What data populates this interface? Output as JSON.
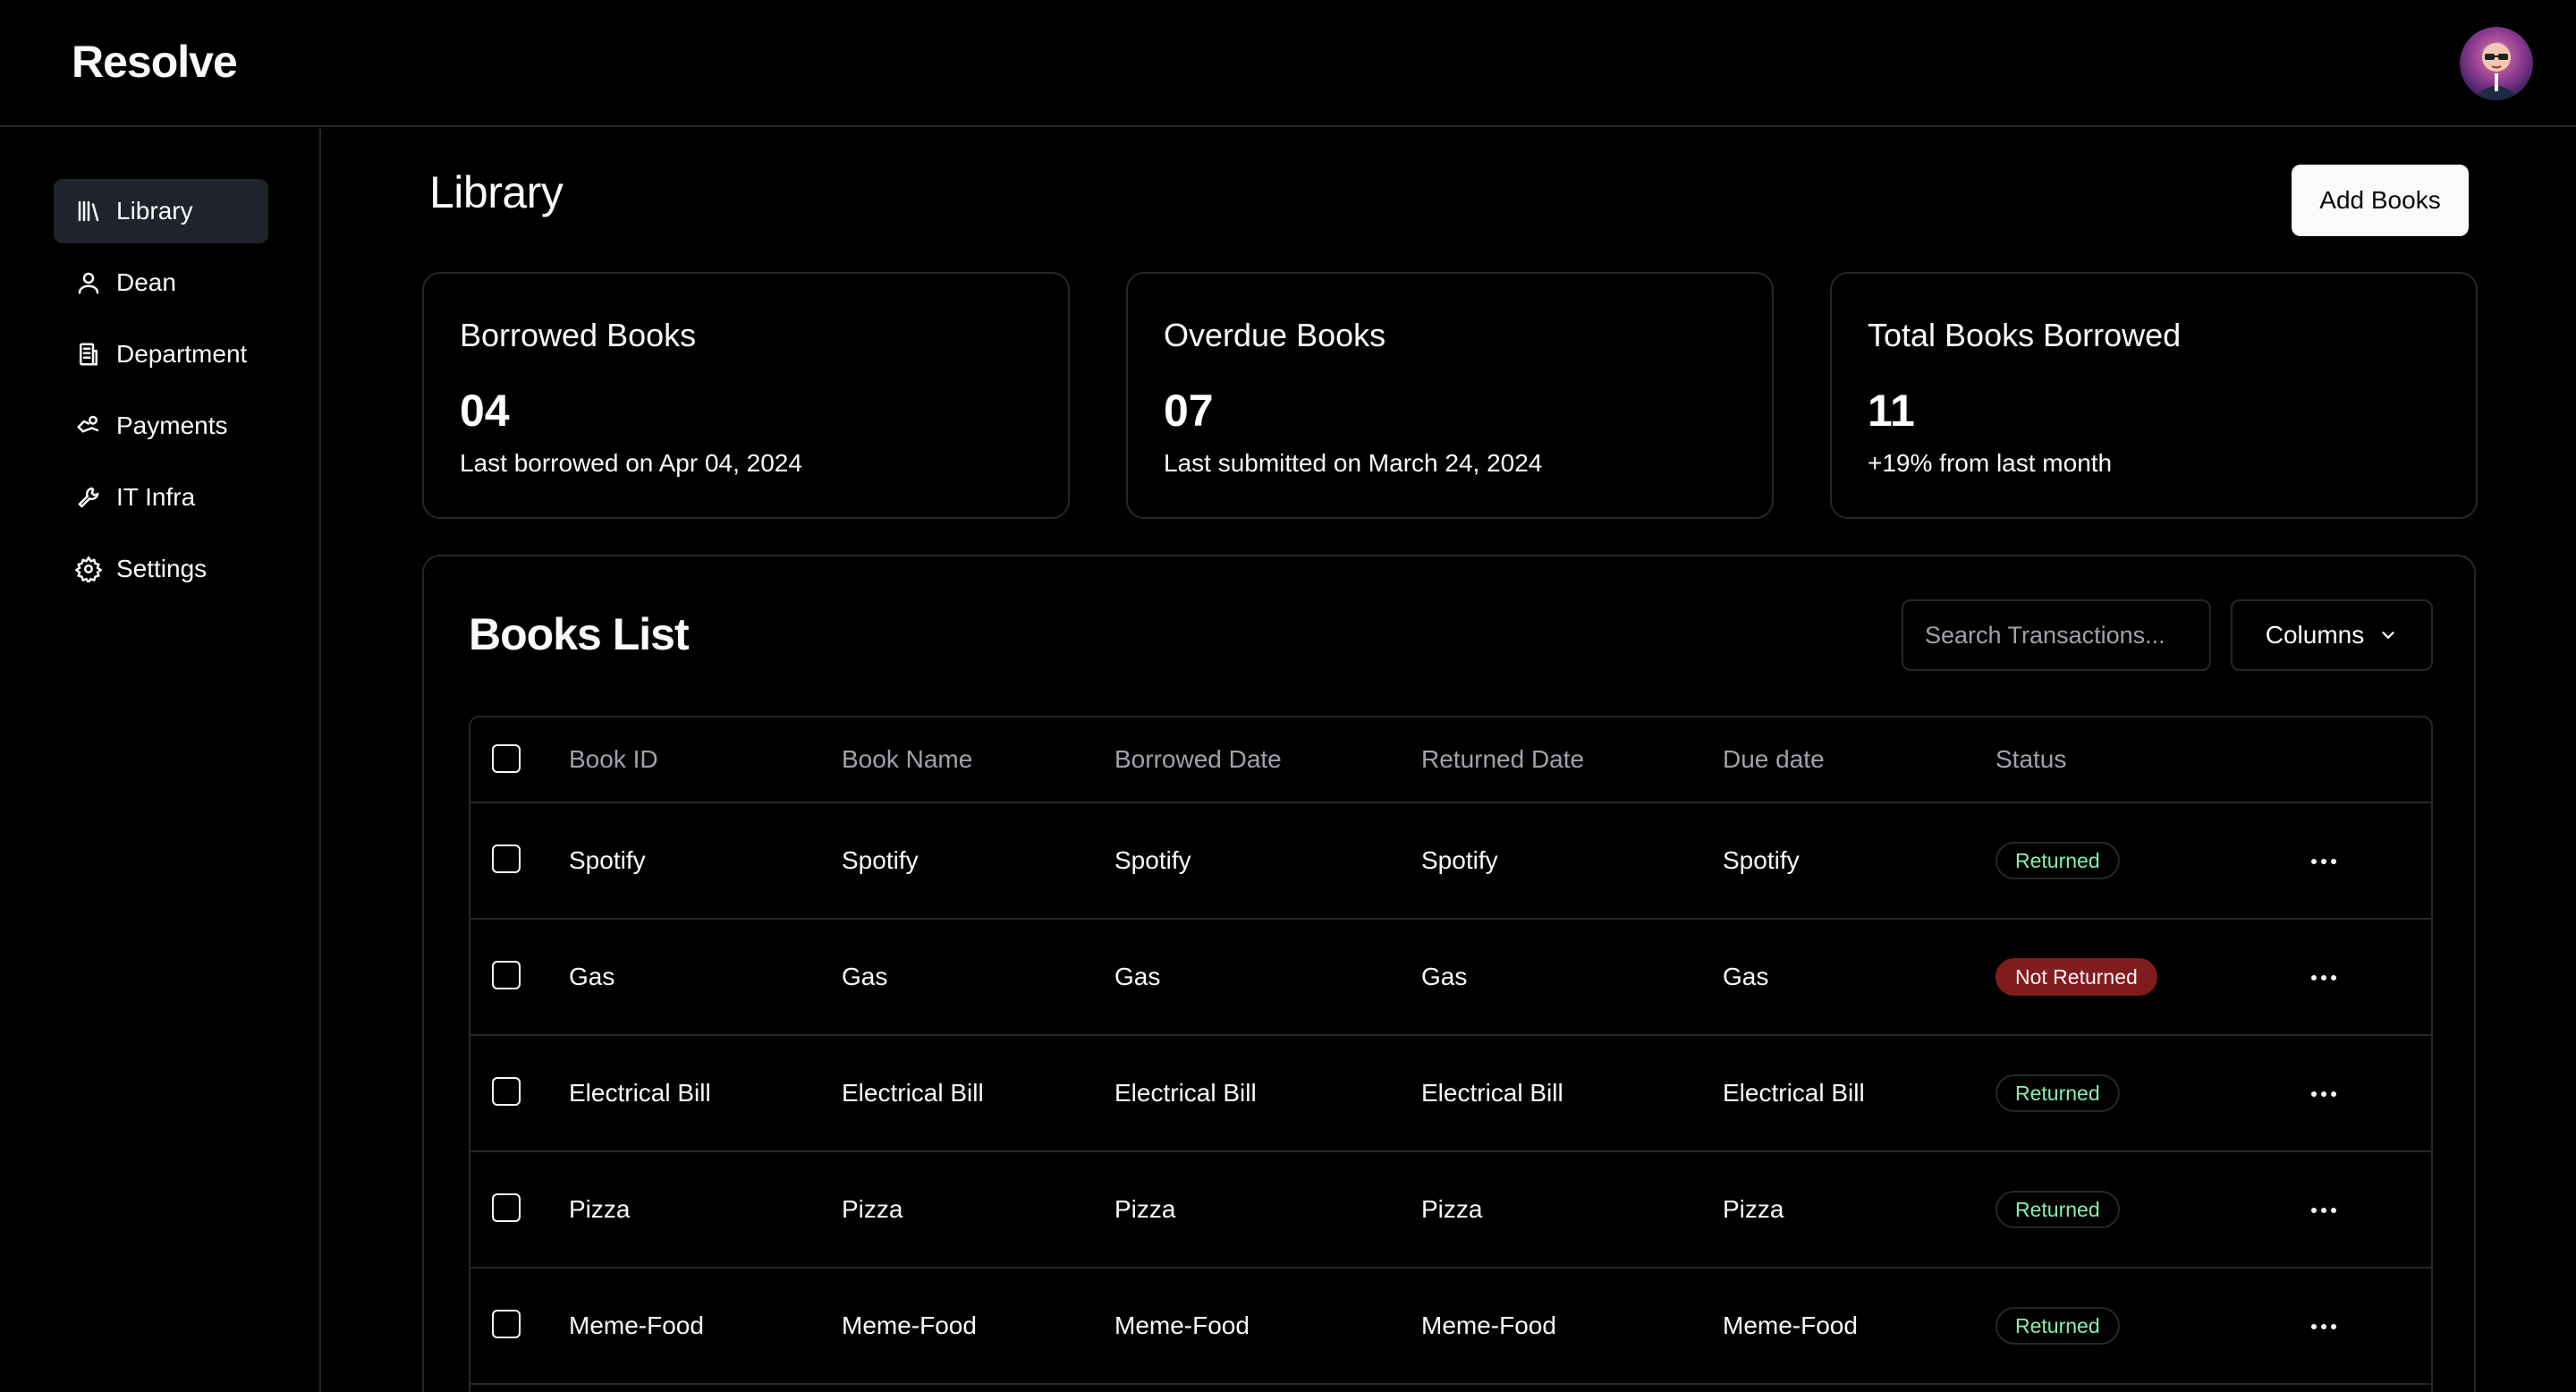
{
  "app": {
    "name": "Resolve"
  },
  "sidebar": {
    "items": [
      {
        "label": "Library",
        "icon": "library-icon",
        "active": true
      },
      {
        "label": "Dean",
        "icon": "user-icon",
        "active": false
      },
      {
        "label": "Department",
        "icon": "building-icon",
        "active": false
      },
      {
        "label": "Payments",
        "icon": "payments-icon",
        "active": false
      },
      {
        "label": "IT Infra",
        "icon": "wrench-icon",
        "active": false
      },
      {
        "label": "Settings",
        "icon": "gear-icon",
        "active": false
      }
    ]
  },
  "main": {
    "title": "Library",
    "add_button": "Add Books",
    "stats": [
      {
        "title": "Borrowed Books",
        "value": "04",
        "sub": "Last borrowed on Apr 04, 2024"
      },
      {
        "title": "Overdue Books",
        "value": "07",
        "sub": "Last submitted on March 24, 2024"
      },
      {
        "title": "Total Books Borrowed",
        "value": "11",
        "sub": "+19% from last month"
      }
    ],
    "books": {
      "title": "Books List",
      "search_placeholder": "Search Transactions...",
      "columns_button": "Columns",
      "headers": [
        "Book ID",
        "Book Name",
        "Borrowed Date",
        "Returned Date",
        "Due date",
        "Status"
      ],
      "rows": [
        {
          "cells": [
            "Spotify",
            "Spotify",
            "Spotify",
            "Spotify",
            "Spotify"
          ],
          "status": "Returned"
        },
        {
          "cells": [
            "Gas",
            "Gas",
            "Gas",
            "Gas",
            "Gas"
          ],
          "status": "Not Returned"
        },
        {
          "cells": [
            "Electrical Bill",
            "Electrical Bill",
            "Electrical Bill",
            "Electrical Bill",
            "Electrical Bill"
          ],
          "status": "Returned"
        },
        {
          "cells": [
            "Pizza",
            "Pizza",
            "Pizza",
            "Pizza",
            "Pizza"
          ],
          "status": "Returned"
        },
        {
          "cells": [
            "Meme-Food",
            "Meme-Food",
            "Meme-Food",
            "Meme-Food",
            "Meme-Food"
          ],
          "status": "Returned"
        }
      ]
    }
  },
  "colors": {
    "background": "#000000",
    "border": "#27272a",
    "active_nav": "#1e232c",
    "returned_text": "#86efac",
    "not_returned_bg": "#7f1d1d"
  }
}
